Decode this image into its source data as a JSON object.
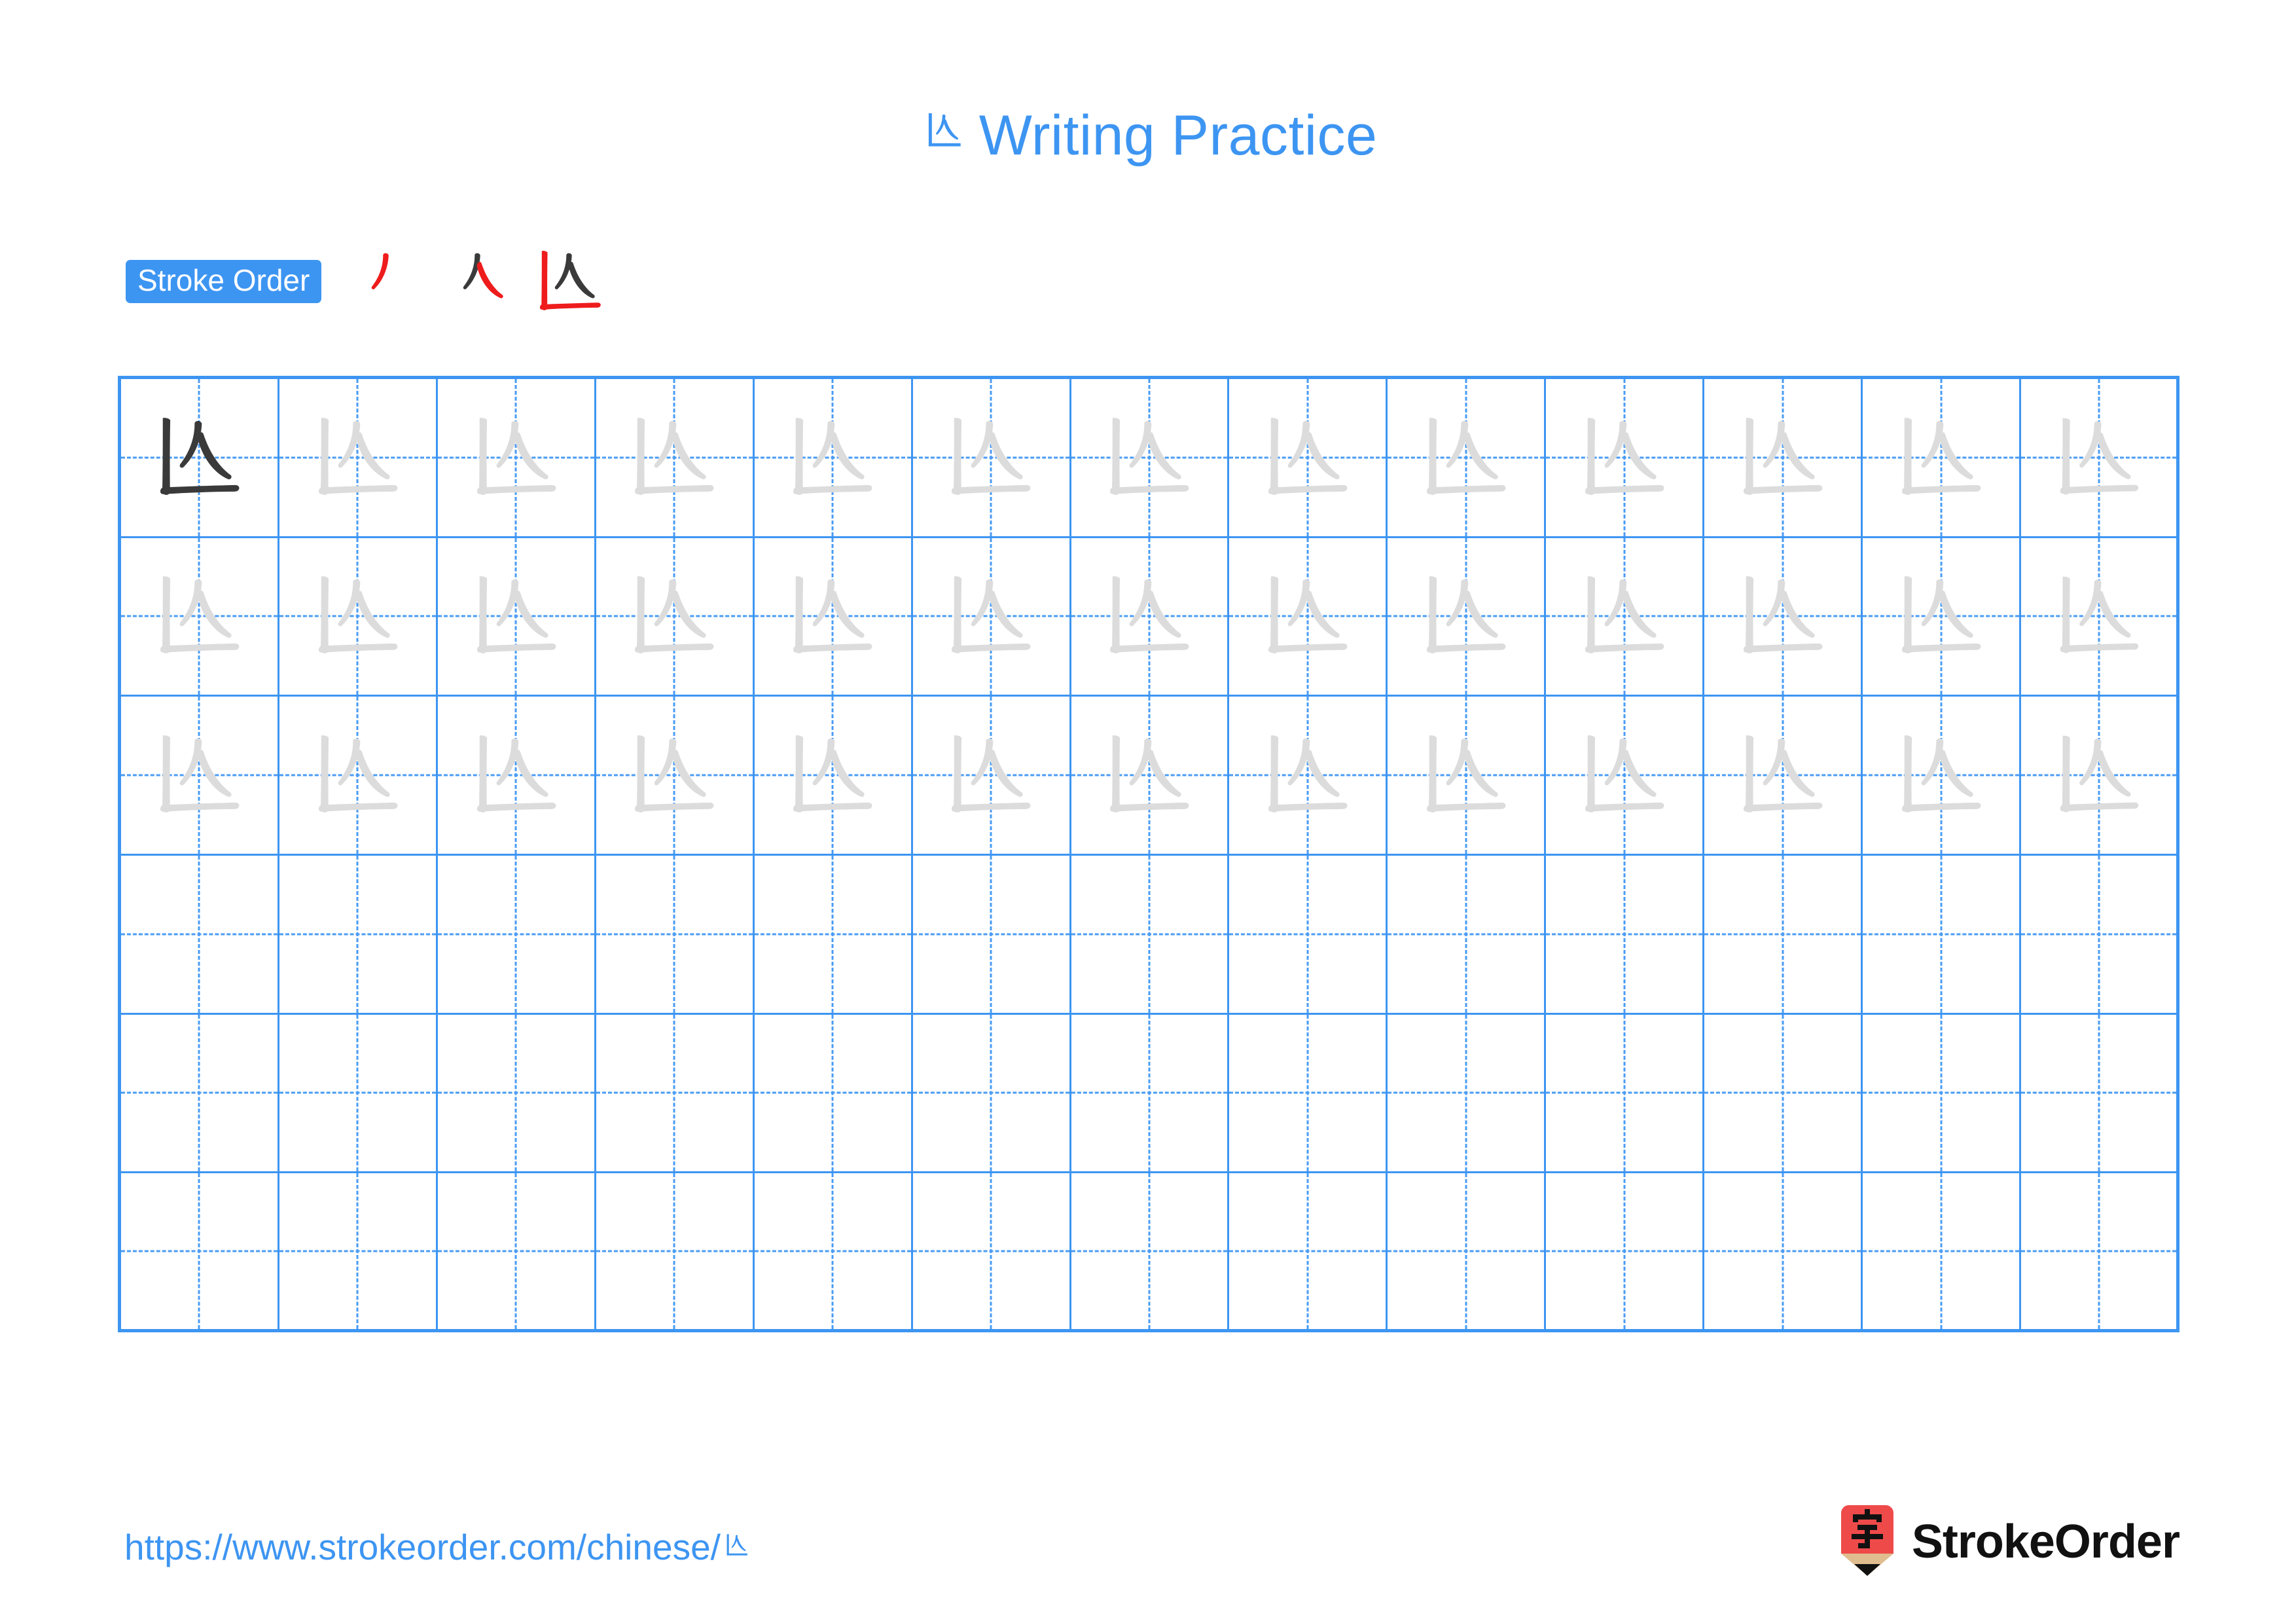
{
  "character": "凶",
  "header": {
    "title_char": "凶",
    "title_text": "Writing Practice"
  },
  "stroke_order": {
    "badge_label": "Stroke Order",
    "steps": [
      {
        "index": 1,
        "name": "stroke-step-1",
        "new_stroke_color": "#ee1c1c",
        "done_stroke_color": "#3a3a3a",
        "strokes_shown": 1
      },
      {
        "index": 2,
        "name": "stroke-step-2",
        "new_stroke_color": "#ee1c1c",
        "done_stroke_color": "#3a3a3a",
        "strokes_shown": 2
      },
      {
        "index": 3,
        "name": "stroke-step-3",
        "new_stroke_color": "#ee1c1c",
        "done_stroke_color": "#3a3a3a",
        "strokes_shown": 4
      }
    ],
    "total_strokes": 4
  },
  "grid": {
    "columns": 13,
    "rows": 6,
    "line_color": "#3d95f2",
    "guide_color": "#4a9cf4",
    "traced_char_color": "#dcdcdc",
    "model_char_color": "#3a3a3a",
    "filled_rows": 3,
    "blank_rows": 3,
    "cells": [
      [
        "model",
        "trace",
        "trace",
        "trace",
        "trace",
        "trace",
        "trace",
        "trace",
        "trace",
        "trace",
        "trace",
        "trace",
        "trace"
      ],
      [
        "trace",
        "trace",
        "trace",
        "trace",
        "trace",
        "trace",
        "trace",
        "trace",
        "trace",
        "trace",
        "trace",
        "trace",
        "trace"
      ],
      [
        "trace",
        "trace",
        "trace",
        "trace",
        "trace",
        "trace",
        "trace",
        "trace",
        "trace",
        "trace",
        "trace",
        "trace",
        "trace"
      ],
      [
        "empty",
        "empty",
        "empty",
        "empty",
        "empty",
        "empty",
        "empty",
        "empty",
        "empty",
        "empty",
        "empty",
        "empty",
        "empty"
      ],
      [
        "empty",
        "empty",
        "empty",
        "empty",
        "empty",
        "empty",
        "empty",
        "empty",
        "empty",
        "empty",
        "empty",
        "empty",
        "empty"
      ],
      [
        "empty",
        "empty",
        "empty",
        "empty",
        "empty",
        "empty",
        "empty",
        "empty",
        "empty",
        "empty",
        "empty",
        "empty",
        "empty"
      ]
    ]
  },
  "footer": {
    "url_prefix": "https://www.strokeorder.com/chinese/",
    "url_char": "凶",
    "brand_name": "StrokeOrder",
    "logo_colors": {
      "body": "#ef4a4a",
      "wood": "#e0bd8f",
      "tip": "#111111",
      "glyph": "#111111"
    },
    "logo_glyph": "字"
  },
  "colors": {
    "accent_blue": "#3d95f2",
    "stroke_red": "#ee1c1c",
    "ink_dark": "#3a3a3a",
    "ink_light": "#dcdcdc",
    "background": "#ffffff"
  }
}
